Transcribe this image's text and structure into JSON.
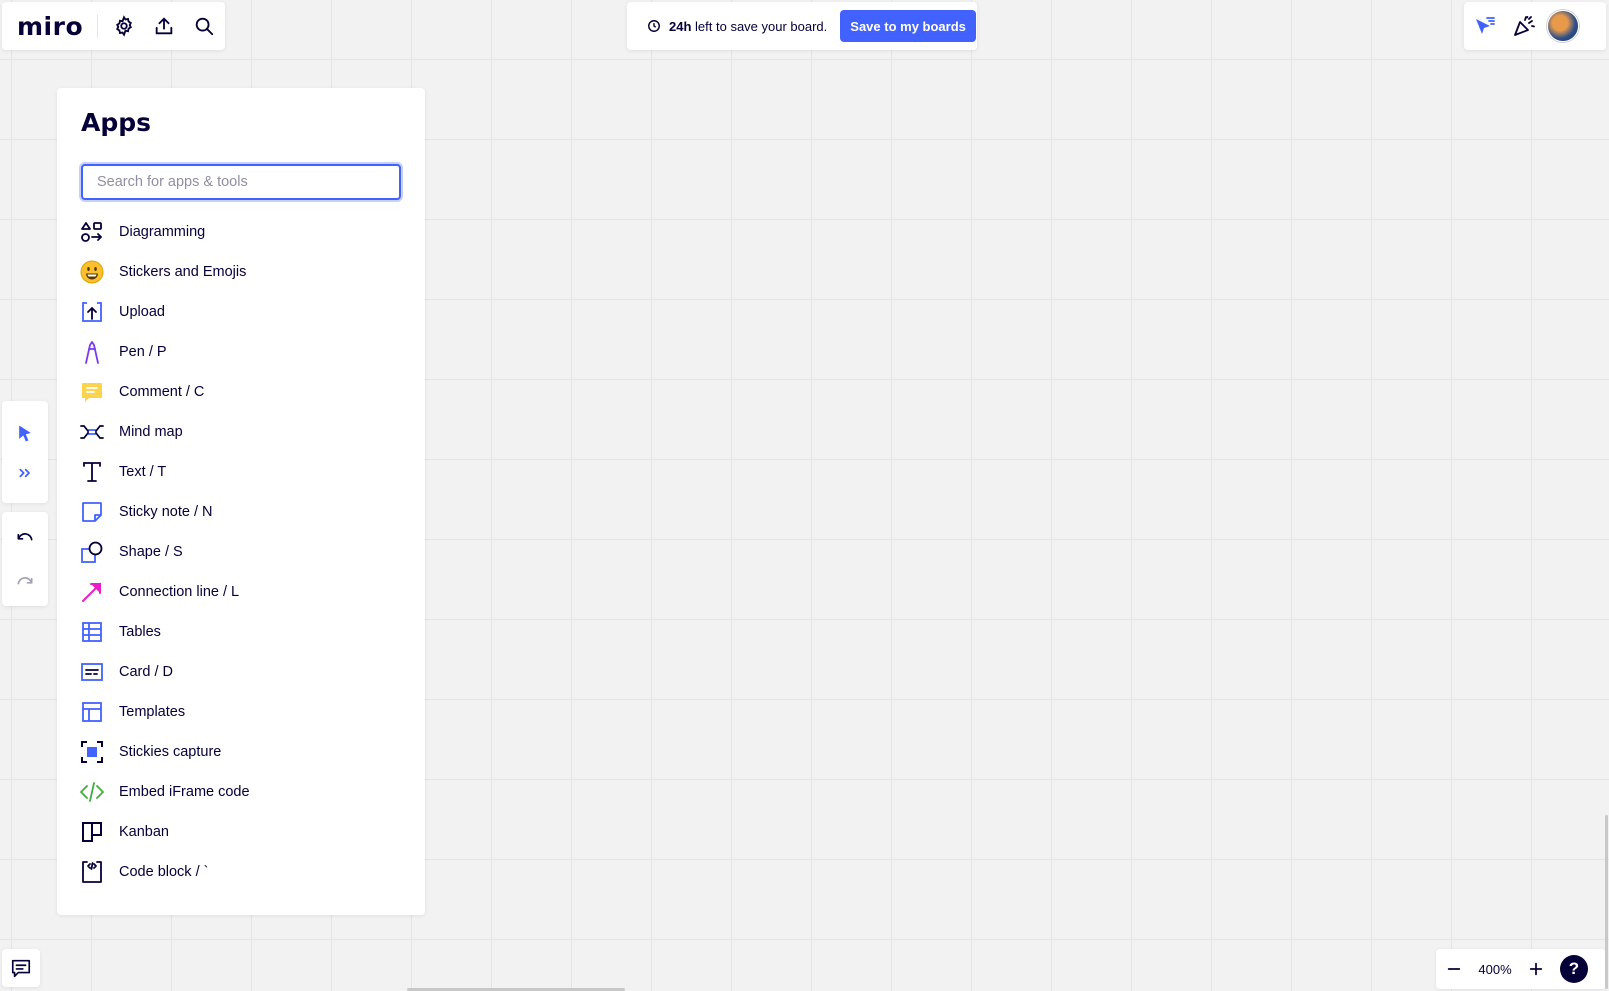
{
  "topbar": {
    "logo": "miro",
    "settings_icon": "gear-icon",
    "export_icon": "upload-icon",
    "search_icon": "search-icon"
  },
  "banner": {
    "time_bold": "24h",
    "message": "left to save your board.",
    "save_button": "Save to my boards"
  },
  "apps_panel": {
    "title": "Apps",
    "search_placeholder": "Search for apps & tools",
    "items": [
      {
        "label": "Diagramming",
        "icon": "diagramming-icon"
      },
      {
        "label": "Stickers and Emojis",
        "icon": "emoji-icon"
      },
      {
        "label": "Upload",
        "icon": "upload-icon"
      },
      {
        "label": "Pen / P",
        "icon": "pen-icon"
      },
      {
        "label": "Comment / C",
        "icon": "comment-icon"
      },
      {
        "label": "Mind map",
        "icon": "mind-map-icon"
      },
      {
        "label": "Text / T",
        "icon": "text-icon"
      },
      {
        "label": "Sticky note / N",
        "icon": "sticky-note-icon"
      },
      {
        "label": "Shape / S",
        "icon": "shape-icon"
      },
      {
        "label": "Connection line / L",
        "icon": "connection-line-icon"
      },
      {
        "label": "Tables",
        "icon": "table-icon"
      },
      {
        "label": "Card / D",
        "icon": "card-icon"
      },
      {
        "label": "Templates",
        "icon": "templates-icon"
      },
      {
        "label": "Stickies capture",
        "icon": "stickies-capture-icon"
      },
      {
        "label": "Embed iFrame code",
        "icon": "embed-code-icon"
      },
      {
        "label": "Kanban",
        "icon": "kanban-icon"
      },
      {
        "label": "Code block / `",
        "icon": "code-block-icon"
      }
    ]
  },
  "zoom": {
    "level": "400%"
  },
  "help": "?",
  "colors": {
    "accent": "#4262ff",
    "text": "#050038",
    "sticker_yellow": "#fbc02d",
    "comment_yellow": "#fcd34d",
    "pen_purple": "#7b3aed",
    "connector_pink": "#e91ec9",
    "embed_green": "#3fae3a"
  }
}
